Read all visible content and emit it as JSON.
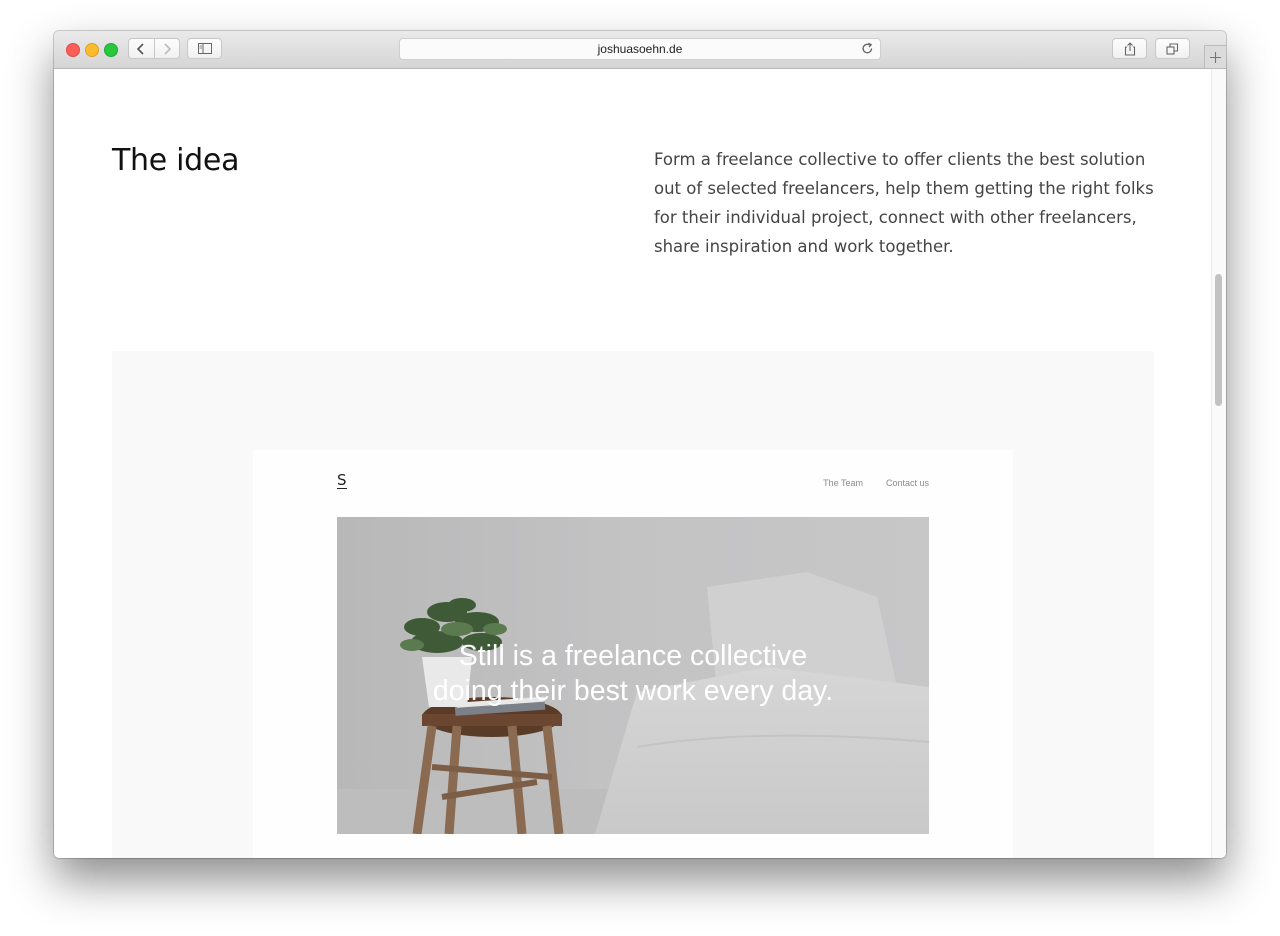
{
  "browser": {
    "url": "joshuasoehn.de"
  },
  "section": {
    "heading": "The idea",
    "body": "Form a freelance collective to offer clients the best solution out of selected freelancers, help them getting the right folks for their individual project, connect with other freelancers, share inspiration and work together."
  },
  "mockup": {
    "logo": "S",
    "nav": [
      "The Team",
      "Contact us"
    ],
    "tagline_line1": "Still is a freelance collective",
    "tagline_line2": "doing their best work every day."
  },
  "colors": {
    "close": "#fc5f57",
    "minimize": "#fdbc2e",
    "maximize": "#27c840"
  },
  "icons": [
    "back-icon",
    "forward-icon",
    "sidebar-icon",
    "reload-icon",
    "share-icon",
    "tabs-overview-icon",
    "plus-icon"
  ]
}
